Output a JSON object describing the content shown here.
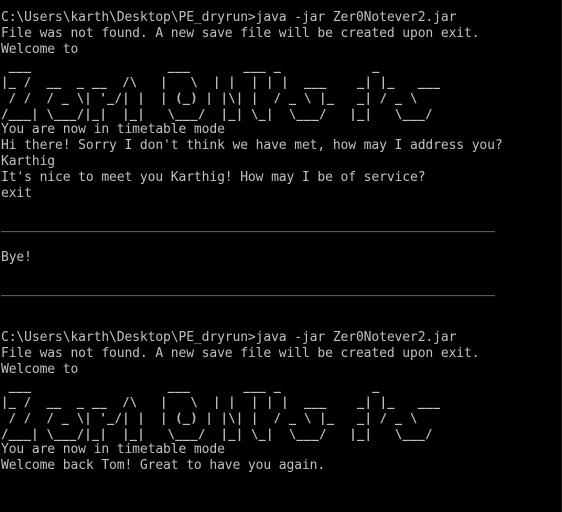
{
  "console": {
    "background": "#000000",
    "foreground": "#c0c0c0",
    "lines": [
      "C:\\Users\\karth\\Desktop\\PE_dryrun>java -jar Zer0Notever2.jar",
      "File was not found. A new save file will be created upon exit.",
      "Welcome to",
      " ___                  ___       ___ _            _",
      "|_ /  __  _ __  /\\   |   \\  | |  | | |  ___    _| |_   ___",
      " / /  / _ \\| '_/| |  | (_) | |\\| |  / _ \\ |_   _| / _ \\",
      "/___| \\___/|_|  |_|   \\___/  |_| \\_|  \\___/   |_|   \\___/",
      "You are now in timetable mode",
      "Hi there! Sorry I don't think we have met, how may I address you?",
      "Karthig",
      "It's nice to meet you Karthig! How may I be of service?",
      "exit",
      "",
      "________________________________________________________________",
      "",
      "Bye!",
      "",
      "________________________________________________________________",
      "",
      "",
      "C:\\Users\\karth\\Desktop\\PE_dryrun>java -jar Zer0Notever2.jar",
      "File was not found. A new save file will be created upon exit.",
      "Welcome to",
      " ___                  ___       ___ _            _",
      "|_ /  __  _ __  /\\   |   \\  | |  | | |  ___    _| |_   ___",
      " / /  / _ \\| '_/| |  | (_) | |\\| |  / _ \\ |_   _| / _ \\",
      "/___| \\___/|_|  |_|   \\___/  |_| \\_|  \\___/   |_|   \\___/",
      "You are now in timetable mode",
      "Welcome back Tom! Great to have you again."
    ]
  }
}
